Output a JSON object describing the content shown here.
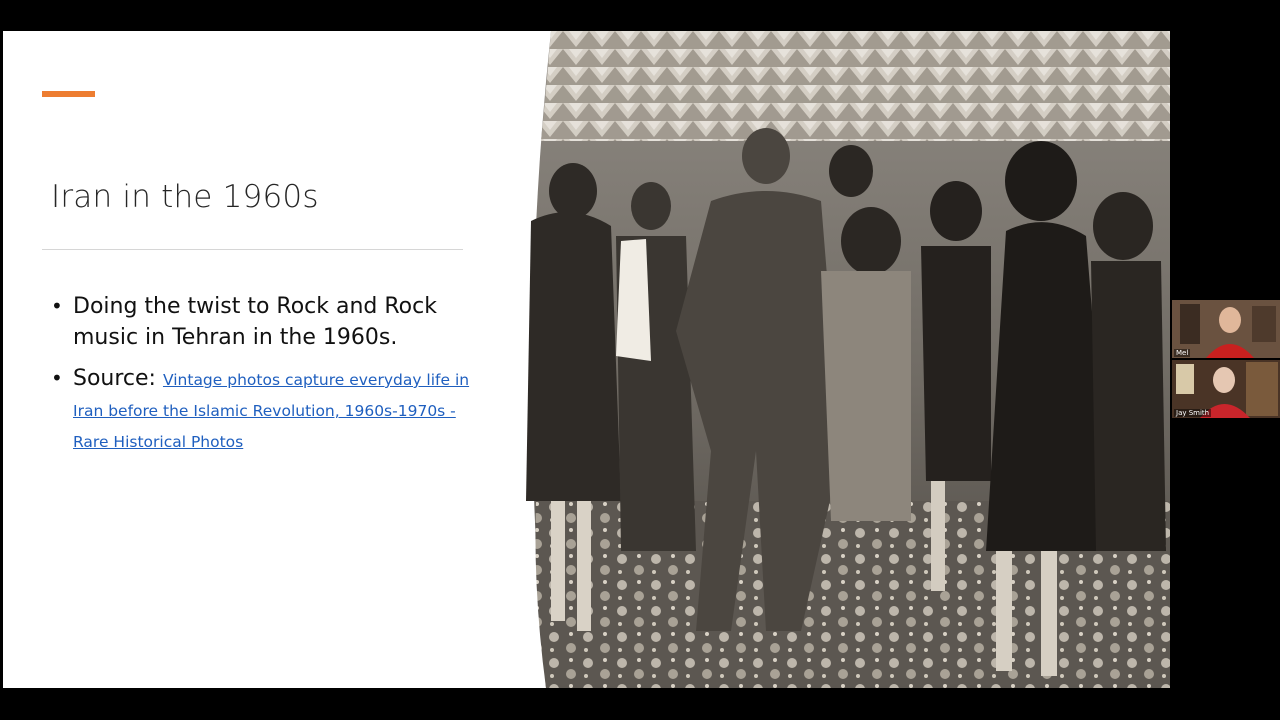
{
  "slide": {
    "title": "Iran in the 1960s",
    "bullets": [
      {
        "text": "Doing the twist to Rock and Rock music in Tehran in the 1960s."
      },
      {
        "prefix": "Source: ",
        "link_text": "Vintage photos capture everyday life in Iran before the Islamic Revolution, 1960s-1970s - Rare Historical Photos"
      }
    ],
    "accent_color": "#ed7d31",
    "link_color": "#1f5fbf",
    "photo": {
      "icon": "dancing-photo-image"
    }
  },
  "participants": [
    {
      "name": "Mel"
    },
    {
      "name": "Jay Smith"
    }
  ]
}
